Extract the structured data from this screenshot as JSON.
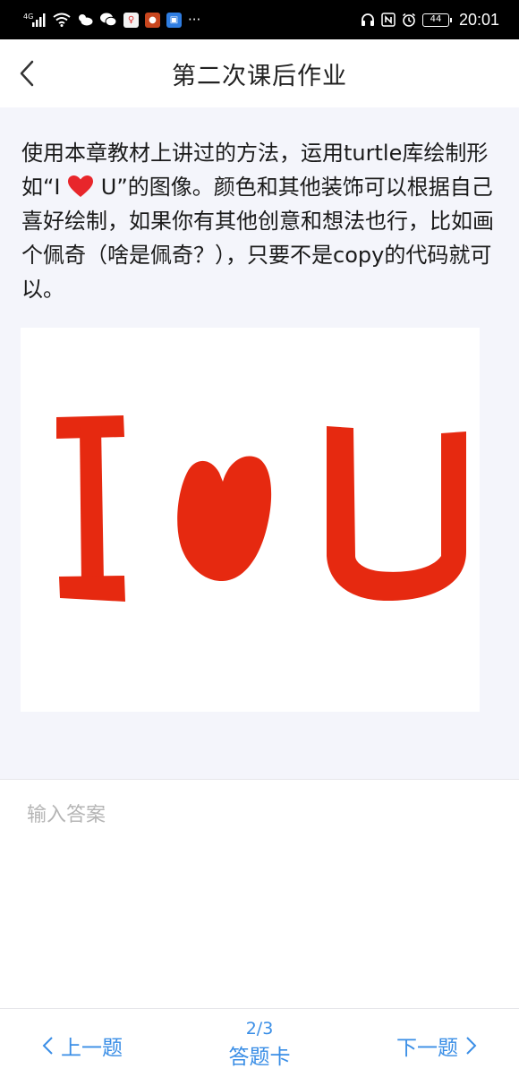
{
  "status_bar": {
    "network": "4G",
    "battery": "44",
    "time": "20:01",
    "more": "···"
  },
  "header": {
    "title": "第二次课后作业"
  },
  "question": {
    "text_before": "使用本章教材上讲过的方法，运用turtle库绘制形如“I ",
    "text_after": " U”的图像。颜色和其他装饰可以根据自己喜好绘制，如果你有其他创意和想法也行，比如画个佩奇（啥是佩奇？），只要不是copy的代码就可以。",
    "heart_color": "#e8262b",
    "image": {
      "letters": [
        "I",
        "U"
      ],
      "color": "#e62910"
    }
  },
  "answer": {
    "placeholder": "输入答案"
  },
  "bottom_nav": {
    "prev_label": "上一题",
    "next_label": "下一题",
    "progress": "2/3",
    "answer_card_label": "答题卡",
    "accent_color": "#3a8ee6"
  }
}
